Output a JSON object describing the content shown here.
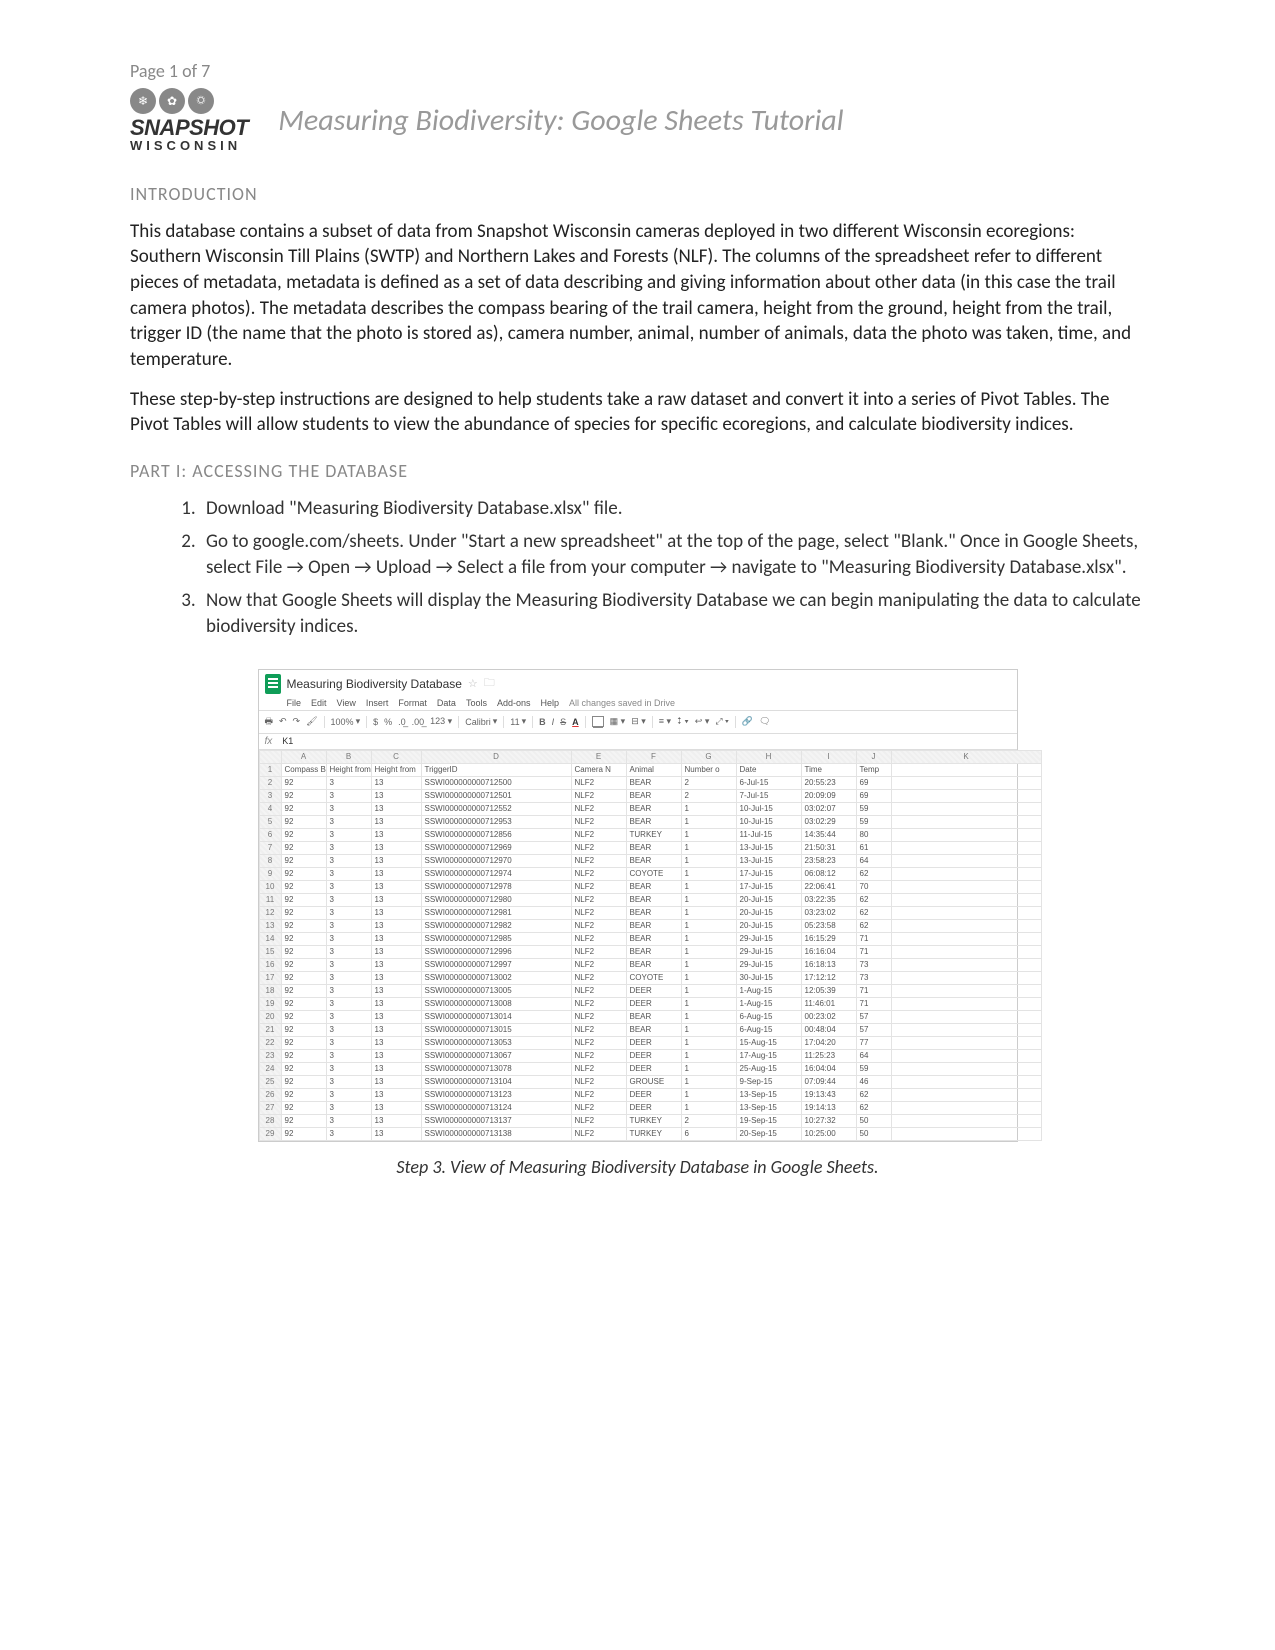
{
  "page_label": "Page 1 of 7",
  "logo": {
    "line1": "SNAPSHOT",
    "line2": "WISCONSIN"
  },
  "title": "Measuring Biodiversity: Google Sheets Tutorial",
  "intro_head": "INTRODUCTION",
  "intro_p1": "This database contains a subset of data from Snapshot Wisconsin cameras deployed in two different Wisconsin ecoregions: Southern Wisconsin Till Plains (SWTP) and Northern Lakes and Forests (NLF). The columns of the spreadsheet refer to different pieces of metadata, metadata is defined as a set of data describing and giving information about other data (in this case the trail camera photos). The metadata describes the compass bearing of the trail camera, height from the ground, height from the trail, trigger ID (the name that the photo is stored as), camera number, animal, number of animals, data the photo was taken, time, and temperature.",
  "intro_p2": "These step-by-step instructions are designed to help students take a raw dataset and convert it into a series of Pivot Tables. The Pivot Tables will allow students to view the abundance of species for specific ecoregions, and calculate biodiversity indices.",
  "part_head": "PART I: ACCESSING THE DATABASE",
  "steps": [
    "Download \"Measuring Biodiversity Database.xlsx\" file.",
    "Go to google.com/sheets. Under \"Start a new spreadsheet\" at the top of the page, select \"Blank.\" Once in Google Sheets, select File → Open → Upload → Select a file from your computer → navigate to \"Measuring Biodiversity Database.xlsx\".",
    "Now that Google Sheets will display the Measuring Biodiversity Database we can begin manipulating the data to calculate biodiversity indices."
  ],
  "caption": "Step 3. View of Measuring Biodiversity Database in Google Sheets.",
  "sheet": {
    "filename": "Measuring Biodiversity Database",
    "menus": [
      "File",
      "Edit",
      "View",
      "Insert",
      "Format",
      "Data",
      "Tools",
      "Add-ons",
      "Help"
    ],
    "saved": "All changes saved in Drive",
    "toolbar": {
      "zoom": "100%",
      "font": "Calibri",
      "size": "11",
      "bold": "B",
      "italic": "I",
      "strike": "S"
    },
    "active_cell": "K1",
    "col_letters": [
      "",
      "A",
      "B",
      "C",
      "D",
      "E",
      "F",
      "G",
      "H",
      "I",
      "J",
      "K"
    ],
    "headers": [
      "Compass B",
      "Height from",
      "Height from",
      "TriggerID",
      "Camera N",
      "Animal",
      "Number o",
      "Date",
      "Time",
      "Temp",
      ""
    ],
    "rows": [
      [
        "92",
        "3",
        "13",
        "SSWI000000000712500",
        "NLF2",
        "BEAR",
        "2",
        "6-Jul-15",
        "20:55:23",
        "69",
        ""
      ],
      [
        "92",
        "3",
        "13",
        "SSWI000000000712501",
        "NLF2",
        "BEAR",
        "2",
        "7-Jul-15",
        "20:09:09",
        "69",
        ""
      ],
      [
        "92",
        "3",
        "13",
        "SSWI000000000712552",
        "NLF2",
        "BEAR",
        "1",
        "10-Jul-15",
        "03:02:07",
        "59",
        ""
      ],
      [
        "92",
        "3",
        "13",
        "SSWI000000000712953",
        "NLF2",
        "BEAR",
        "1",
        "10-Jul-15",
        "03:02:29",
        "59",
        ""
      ],
      [
        "92",
        "3",
        "13",
        "SSWI000000000712856",
        "NLF2",
        "TURKEY",
        "1",
        "11-Jul-15",
        "14:35:44",
        "80",
        ""
      ],
      [
        "92",
        "3",
        "13",
        "SSWI000000000712969",
        "NLF2",
        "BEAR",
        "1",
        "13-Jul-15",
        "21:50:31",
        "61",
        ""
      ],
      [
        "92",
        "3",
        "13",
        "SSWI000000000712970",
        "NLF2",
        "BEAR",
        "1",
        "13-Jul-15",
        "23:58:23",
        "64",
        ""
      ],
      [
        "92",
        "3",
        "13",
        "SSWI000000000712974",
        "NLF2",
        "COYOTE",
        "1",
        "17-Jul-15",
        "06:08:12",
        "62",
        ""
      ],
      [
        "92",
        "3",
        "13",
        "SSWI000000000712978",
        "NLF2",
        "BEAR",
        "1",
        "17-Jul-15",
        "22:06:41",
        "70",
        ""
      ],
      [
        "92",
        "3",
        "13",
        "SSWI000000000712980",
        "NLF2",
        "BEAR",
        "1",
        "20-Jul-15",
        "03:22:35",
        "62",
        ""
      ],
      [
        "92",
        "3",
        "13",
        "SSWI000000000712981",
        "NLF2",
        "BEAR",
        "1",
        "20-Jul-15",
        "03:23:02",
        "62",
        ""
      ],
      [
        "92",
        "3",
        "13",
        "SSWI000000000712982",
        "NLF2",
        "BEAR",
        "1",
        "20-Jul-15",
        "05:23:58",
        "62",
        ""
      ],
      [
        "92",
        "3",
        "13",
        "SSWI000000000712985",
        "NLF2",
        "BEAR",
        "1",
        "29-Jul-15",
        "16:15:29",
        "71",
        ""
      ],
      [
        "92",
        "3",
        "13",
        "SSWI000000000712996",
        "NLF2",
        "BEAR",
        "1",
        "29-Jul-15",
        "16:16:04",
        "71",
        ""
      ],
      [
        "92",
        "3",
        "13",
        "SSWI000000000712997",
        "NLF2",
        "BEAR",
        "1",
        "29-Jul-15",
        "16:18:13",
        "73",
        ""
      ],
      [
        "92",
        "3",
        "13",
        "SSWI000000000713002",
        "NLF2",
        "COYOTE",
        "1",
        "30-Jul-15",
        "17:12:12",
        "73",
        ""
      ],
      [
        "92",
        "3",
        "13",
        "SSWI000000000713005",
        "NLF2",
        "DEER",
        "1",
        "1-Aug-15",
        "12:05:39",
        "71",
        ""
      ],
      [
        "92",
        "3",
        "13",
        "SSWI000000000713008",
        "NLF2",
        "DEER",
        "1",
        "1-Aug-15",
        "11:46:01",
        "71",
        ""
      ],
      [
        "92",
        "3",
        "13",
        "SSWI000000000713014",
        "NLF2",
        "BEAR",
        "1",
        "6-Aug-15",
        "00:23:02",
        "57",
        ""
      ],
      [
        "92",
        "3",
        "13",
        "SSWI000000000713015",
        "NLF2",
        "BEAR",
        "1",
        "6-Aug-15",
        "00:48:04",
        "57",
        ""
      ],
      [
        "92",
        "3",
        "13",
        "SSWI000000000713053",
        "NLF2",
        "DEER",
        "1",
        "15-Aug-15",
        "17:04:20",
        "77",
        ""
      ],
      [
        "92",
        "3",
        "13",
        "SSWI000000000713067",
        "NLF2",
        "DEER",
        "1",
        "17-Aug-15",
        "11:25:23",
        "64",
        ""
      ],
      [
        "92",
        "3",
        "13",
        "SSWI000000000713078",
        "NLF2",
        "DEER",
        "1",
        "25-Aug-15",
        "16:04:04",
        "59",
        ""
      ],
      [
        "92",
        "3",
        "13",
        "SSWI000000000713104",
        "NLF2",
        "GROUSE",
        "1",
        "9-Sep-15",
        "07:09:44",
        "46",
        ""
      ],
      [
        "92",
        "3",
        "13",
        "SSWI000000000713123",
        "NLF2",
        "DEER",
        "1",
        "13-Sep-15",
        "19:13:43",
        "62",
        ""
      ],
      [
        "92",
        "3",
        "13",
        "SSWI000000000713124",
        "NLF2",
        "DEER",
        "1",
        "13-Sep-15",
        "19:14:13",
        "62",
        ""
      ],
      [
        "92",
        "3",
        "13",
        "SSWI000000000713137",
        "NLF2",
        "TURKEY",
        "2",
        "19-Sep-15",
        "10:27:32",
        "50",
        ""
      ],
      [
        "92",
        "3",
        "13",
        "SSWI000000000713138",
        "NLF2",
        "TURKEY",
        "6",
        "20-Sep-15",
        "10:25:00",
        "50",
        ""
      ]
    ]
  }
}
